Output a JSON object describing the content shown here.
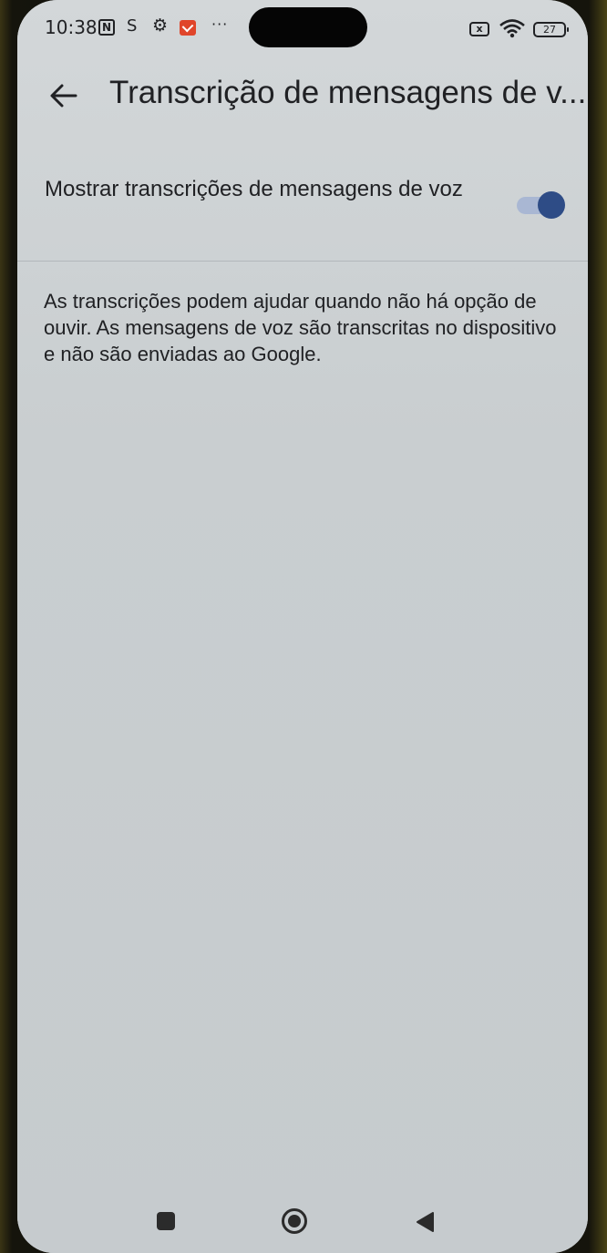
{
  "status_bar": {
    "time": "10:38",
    "n_icon_letter": "N",
    "s_icon": "S",
    "more": "···",
    "battery_saver_letter": "x",
    "battery_level": "27"
  },
  "app_bar": {
    "back_icon": "arrow-left",
    "title": "Transcrição de mensagens de v..."
  },
  "setting": {
    "label": "Mostrar transcrições de mensagens de voz",
    "toggle_on": true
  },
  "description": "As transcrições podem ajudar quando não há opção de ouvir. As mensagens de voz são transcritas no dispositivo e não são enviadas ao Google.",
  "nav_bar": {
    "recents_icon": "square",
    "home_icon": "circle",
    "back_icon": "triangle-left"
  },
  "colors": {
    "background": "#c9ced1",
    "text": "#202124",
    "toggle_thumb": "#2e4c86",
    "toggle_track": "#a9b7d3",
    "notification_accent": "#e0452a"
  }
}
